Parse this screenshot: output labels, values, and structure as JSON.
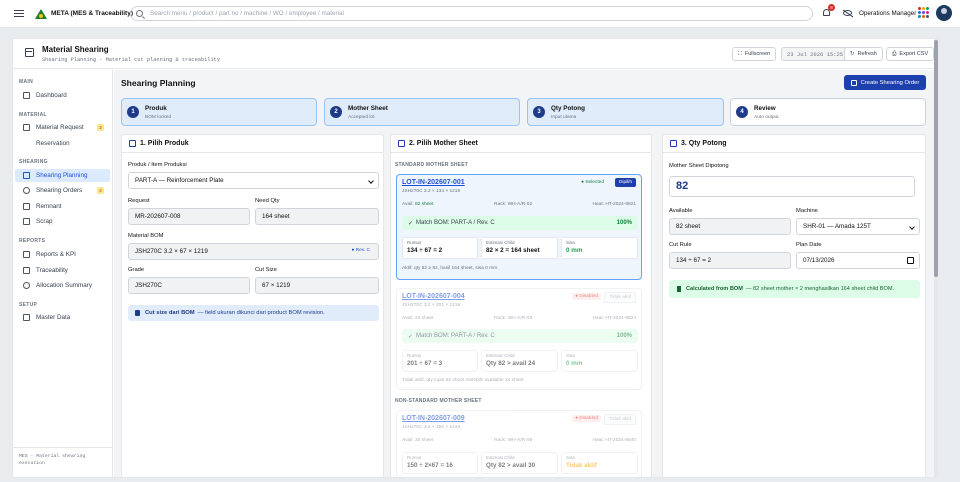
{
  "topbar": {
    "app_name": "META (MES & Traceability)",
    "search_placeholder": "Search menu / product / part no / machine / WO / employee / material",
    "notif_count": "8",
    "role": "Operations Manager"
  },
  "header": {
    "title": "Material Shearing",
    "subtitle": "Shearing Planning - Material cut planning & traceability",
    "fullscreen": "Fullscreen",
    "date": "23 Jul 2026 15:25",
    "refresh": "Refresh",
    "export": "Export CSV"
  },
  "sidebar": {
    "sections": [
      {
        "label": "MAIN",
        "items": [
          {
            "label": "Dashboard",
            "badge": ""
          }
        ]
      },
      {
        "label": "MATERIAL",
        "items": [
          {
            "label": "Material Request",
            "badge": "2"
          },
          {
            "label": "Reservation",
            "badge": ""
          }
        ]
      },
      {
        "label": "SHEARING",
        "items": [
          {
            "label": "Shearing Planning",
            "badge": ""
          },
          {
            "label": "Shearing Orders",
            "badge": "4"
          },
          {
            "label": "Remnant",
            "badge": ""
          },
          {
            "label": "Scrap",
            "badge": ""
          }
        ]
      },
      {
        "label": "REPORTS",
        "items": [
          {
            "label": "Reports & KPI",
            "badge": ""
          },
          {
            "label": "Traceability",
            "badge": ""
          },
          {
            "label": "Allocation Summary",
            "badge": ""
          }
        ]
      },
      {
        "label": "SETUP",
        "items": [
          {
            "label": "Master Data",
            "badge": ""
          }
        ]
      }
    ],
    "footer": "MES - Material shearing execution"
  },
  "page": {
    "title": "Shearing Planning",
    "create_button": "Create Shearing Order"
  },
  "steps": [
    {
      "num": "1",
      "title": "Produk",
      "sub": "BOM locked"
    },
    {
      "num": "2",
      "title": "Mother Sheet",
      "sub": "Accepted lot"
    },
    {
      "num": "3",
      "title": "Qty Potong",
      "sub": "Input utama"
    },
    {
      "num": "4",
      "title": "Review",
      "sub": "Auto output"
    }
  ],
  "produk": {
    "title": "1. Pilih Produk",
    "product_label": "Produk / Item Produksi",
    "product_value": "PART-A — Reinforcement Plate",
    "request_label": "Request",
    "request_value": "MR-202607-008",
    "need_label": "Need Qty",
    "need_value": "164 sheet",
    "bom_label": "Material BOM",
    "bom_value": "JSH270C 3.2 × 67 × 1219",
    "bom_rev": "● Rev. C",
    "grade_label": "Grade",
    "grade_value": "JSH270C",
    "cut_label": "Cut Size",
    "cut_value": "67 × 1219",
    "info_bold": "Cut size dari BOM",
    "info_rest": "— field ukuran dikunci dari product BOM revision."
  },
  "mother": {
    "title": "2. Pilih Mother Sheet",
    "standard_label": "STANDARD MOTHER SHEET",
    "nonstandard_label": "NON-STANDARD MOTHER SHEET",
    "lots": [
      {
        "id": "LOT-IN-202607-001",
        "spec": "JSH270C 3.2 × 134 × 1219",
        "status": "● Selected",
        "button": "Dipilih",
        "avail_prefix": "Avail:",
        "avail": "82 sheet",
        "rack": "Rack: WH-A/R-02",
        "heat": "Heat: HT-2024-8821",
        "match": "Match BOM: PART-A / Rev. C",
        "match_pct": "100%",
        "rumus_k": "Rumus",
        "rumus_v": "134 ÷ 67 = 2",
        "est_k": "Estimasi Child",
        "est_v": "82 × 2 = 164 sheet",
        "sisa_k": "Sisa",
        "sisa_v": "0 mm",
        "note": "Aktif: qty 82 ≥ 82, hasil 164 sheet, sisa 0 mm."
      },
      {
        "id": "LOT-IN-202607-004",
        "spec": "JSH270C 3.2 × 201 × 1219",
        "status": "● Disabled",
        "button": "Tidak aktif",
        "avail_prefix": "Avail:",
        "avail": "24 sheet",
        "rack": "Rack: WH-A/R-03",
        "heat": "Heat: HT-2024-8824",
        "match": "Match BOM: PART-A / Rev. C",
        "match_pct": "100%",
        "rumus_k": "Rumus",
        "rumus_v": "201 ÷ 67 = 3",
        "est_k": "Estimasi Child",
        "est_v": "Qty 82 > avail 24",
        "sisa_k": "Sisa",
        "sisa_v": "0 mm",
        "note": "Tidak aktif: qty input 82 sheet melebihi available 24 sheet."
      },
      {
        "id": "LOT-IN-202607-009",
        "spec": "JSH270C 3.2 × 150 × 1219",
        "status": "● Disabled",
        "button": "Tidak aktif",
        "avail_prefix": "Avail:",
        "avail": "30 sheet",
        "rack": "Rack: WH-A/R-06",
        "heat": "Heat: HT-2024-8840",
        "rumus_k": "Rumus",
        "rumus_v": "150 ÷ 2×67 = 16",
        "est_k": "Estimasi Child",
        "est_v": "Qty 82 > avail 30",
        "sisa_k": "Sisa",
        "sisa_v": "Tidak aktif"
      }
    ]
  },
  "qty": {
    "title": "3. Qty Potong",
    "ms_label": "Mother Sheet Dipotong",
    "ms_value": "82",
    "avail_label": "Available",
    "avail_value": "82 sheet",
    "machine_label": "Machine",
    "machine_value": "SHR-01 — Amada 125T",
    "rule_label": "Cut Rule",
    "rule_value": "134 ÷ 67 = 2",
    "date_label": "Plan Date",
    "date_value": "07/13/2026",
    "calc_bold": "Calculated from BOM",
    "calc_rest": "— 82 sheet mother × 2 menghasilkan 164 sheet child BOM."
  }
}
